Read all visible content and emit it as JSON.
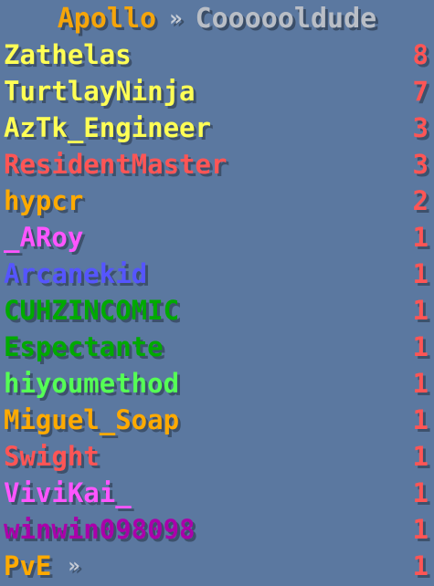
{
  "header": {
    "team": "Apollo",
    "separator": "»",
    "player": "Coooooldude",
    "colors": {
      "team": "#f5a50a",
      "separator": "#c6ccd6",
      "player": "#b9bec6"
    }
  },
  "score_color": "#ff5555",
  "rows": [
    {
      "name": "Zathelas",
      "score": "8",
      "color": "#ffff55"
    },
    {
      "name": "TurtlayNinja",
      "score": "7",
      "color": "#ffff55"
    },
    {
      "name": "AzTk_Engineer",
      "score": "3",
      "color": "#ffff55"
    },
    {
      "name": "ResidentMaster",
      "score": "3",
      "color": "#ff5555"
    },
    {
      "name": "hypcr",
      "score": "2",
      "color": "#ffaa00"
    },
    {
      "name": "_ARoy",
      "score": "1",
      "color": "#ff55ff"
    },
    {
      "name": "Arcanekid",
      "score": "1",
      "color": "#5555ff"
    },
    {
      "name": "CUHZINCOMIC",
      "score": "1",
      "color": "#00aa00"
    },
    {
      "name": "Espectante",
      "score": "1",
      "color": "#00aa00"
    },
    {
      "name": "hiyoumethod",
      "score": "1",
      "color": "#55ff55"
    },
    {
      "name": "Miguel_Soap",
      "score": "1",
      "color": "#ffaa00"
    },
    {
      "name": "Swight",
      "score": "1",
      "color": "#ff5555"
    },
    {
      "name": "ViviKai_",
      "score": "1",
      "color": "#ff55ff"
    },
    {
      "name": "winwin098098",
      "score": "1",
      "color": "#aa00aa"
    },
    {
      "name": "PvE",
      "suffix": "»",
      "score": "1",
      "color": "#ffaa00",
      "suffix_color": "#c6ccd6"
    }
  ]
}
